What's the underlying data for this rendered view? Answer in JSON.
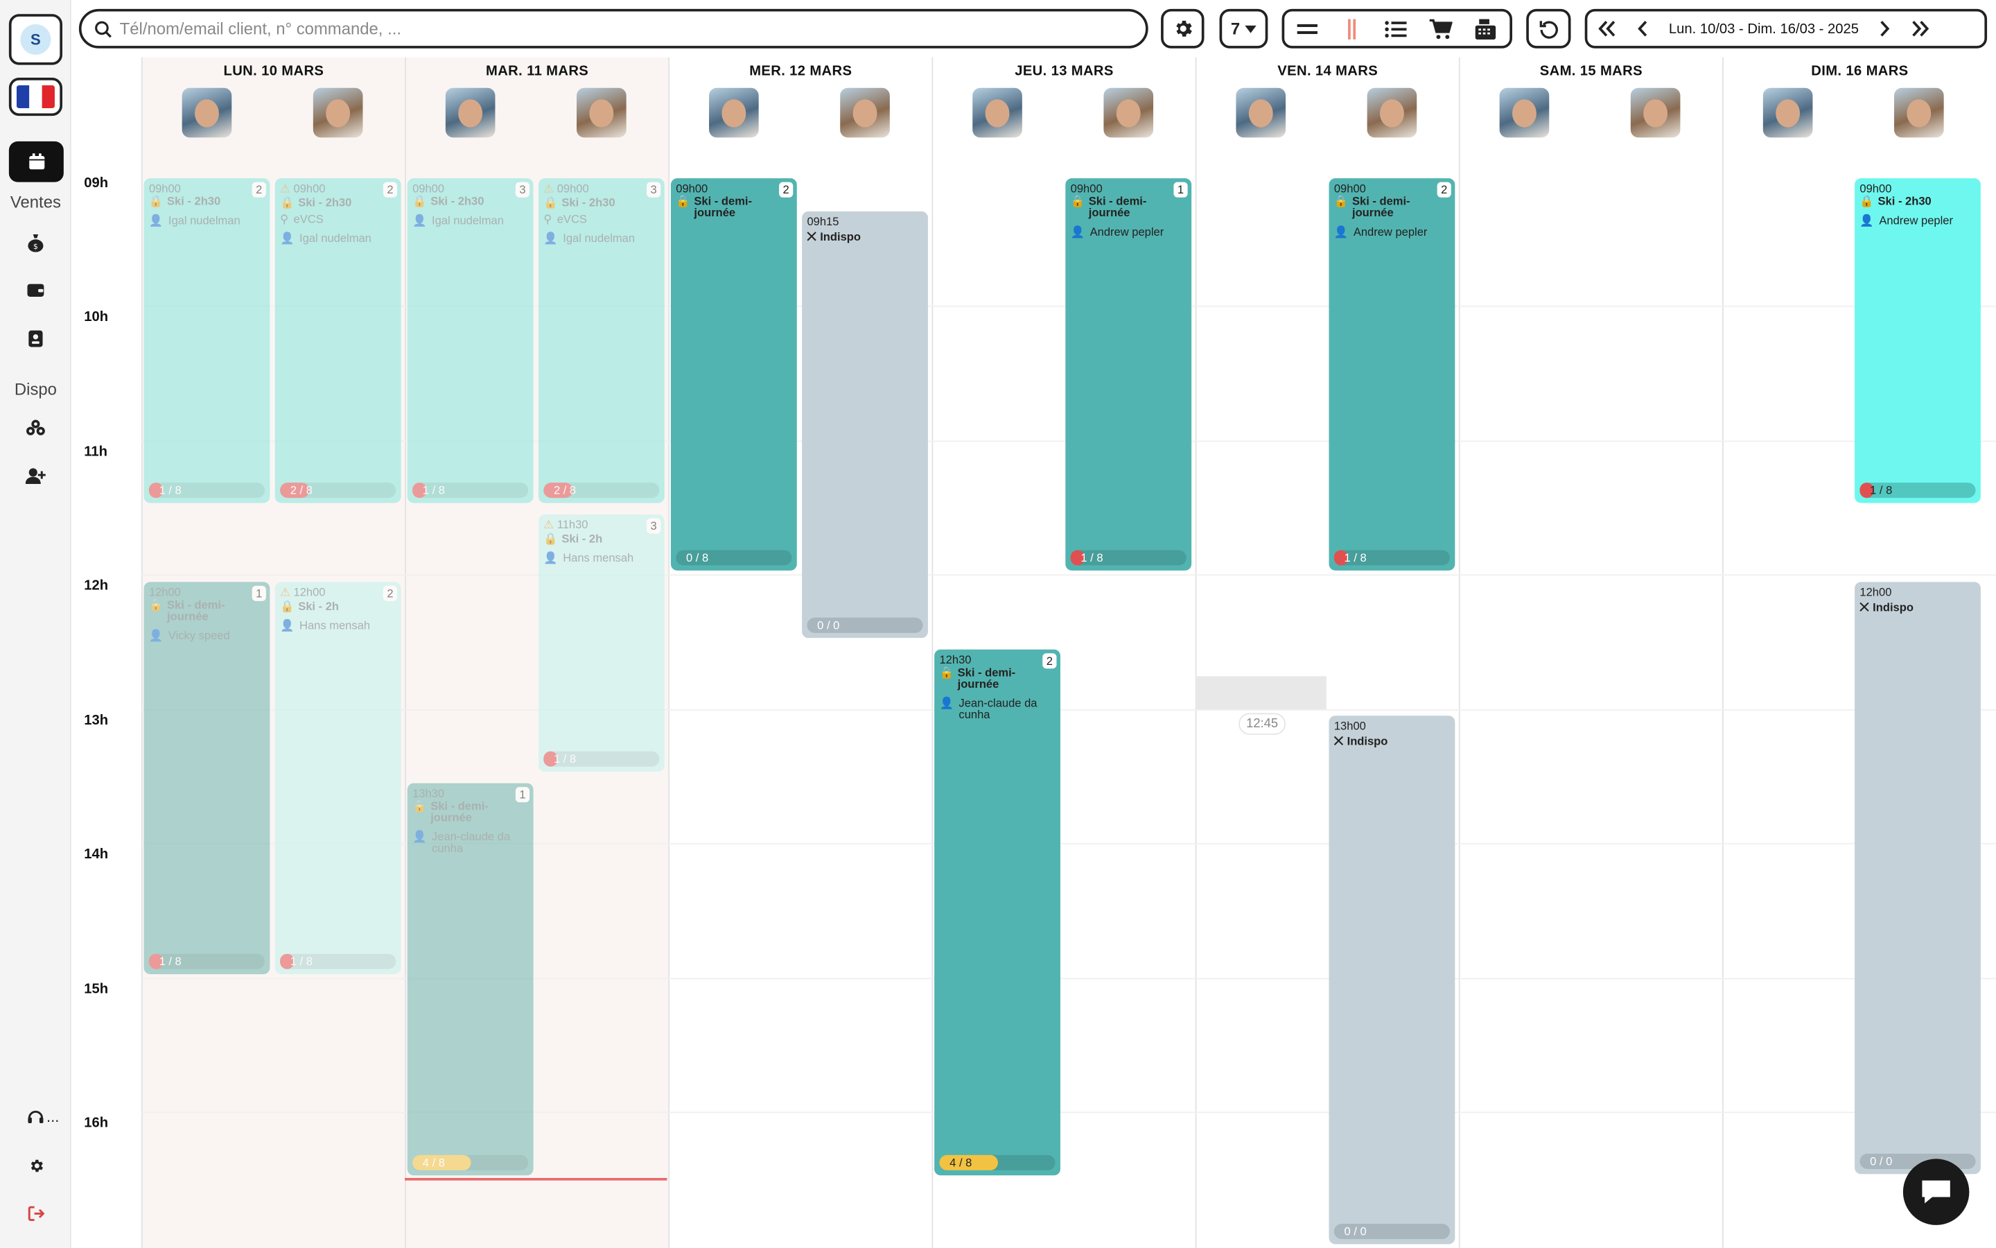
{
  "sidebar": {
    "user_initial": "S",
    "ventes_label": "Ventes",
    "dispo_label": "Dispo",
    "support_label": "..."
  },
  "search": {
    "placeholder": "Tél/nom/email client, n° commande, ..."
  },
  "toolbar": {
    "days_count": "7",
    "date_range": "Lun. 10/03 - Dim. 16/03 - 2025"
  },
  "times": [
    "09h",
    "10h",
    "11h",
    "12h",
    "13h",
    "14h",
    "15h",
    "16h"
  ],
  "days": [
    {
      "label": "LUN. 10 MARS"
    },
    {
      "label": "MAR. 11 MARS"
    },
    {
      "label": "MER. 12 MARS"
    },
    {
      "label": "JEU. 13 MARS"
    },
    {
      "label": "VEN. 14 MARS"
    },
    {
      "label": "SAM. 15 MARS"
    },
    {
      "label": "DIM. 16 MARS"
    }
  ],
  "events": [
    {
      "time": "09h00",
      "title": "Ski - 2h30",
      "who": "Igal nudelman",
      "count": "2",
      "progress": "1 / 8"
    },
    {
      "time": "09h00",
      "title": "Ski - 2h30",
      "location": "eVCS",
      "who": "Igal nudelman",
      "count": "2",
      "progress": "2 / 8"
    },
    {
      "time": "12h00",
      "title": "Ski - demi-journée",
      "who": "Vicky speed",
      "count": "1",
      "progress": "1 / 8"
    },
    {
      "time": "12h00",
      "title": "Ski - 2h",
      "who": "Hans mensah",
      "count": "2",
      "progress": "1 / 8"
    },
    {
      "time": "09h00",
      "title": "Ski - 2h30",
      "who": "Igal nudelman",
      "count": "3",
      "progress": "1 / 8"
    },
    {
      "time": "09h00",
      "title": "Ski - 2h30",
      "location": "eVCS",
      "who": "Igal nudelman",
      "count": "3",
      "progress": "2 / 8"
    },
    {
      "time": "11h30",
      "title": "Ski - 2h",
      "who": "Hans mensah",
      "count": "3",
      "progress": "1 / 8"
    },
    {
      "time": "13h30",
      "title": "Ski - demi-journée",
      "who": "Jean-claude da cunha",
      "count": "1",
      "progress": "4 / 8"
    },
    {
      "time": "09h00",
      "title": "Ski - demi-journée",
      "count": "2",
      "progress": "0 / 8"
    },
    {
      "time": "09h15",
      "title": "Indispo",
      "progress": "0 / 0"
    },
    {
      "time": "12h30",
      "title": "Ski - demi-journée",
      "who": "Jean-claude da cunha",
      "count": "2",
      "progress": "4 / 8"
    },
    {
      "time": "09h00",
      "title": "Ski - demi-journée",
      "who": "Andrew pepler",
      "count": "1",
      "progress": "1 / 8"
    },
    {
      "time": "09h00",
      "title": "Ski - demi-journée",
      "who": "Andrew pepler",
      "count": "2",
      "progress": "1 / 8"
    },
    {
      "time": "13h00",
      "title": "Indispo",
      "progress": "0 / 0"
    },
    {
      "time": "09h00",
      "title": "Ski - 2h30",
      "who": "Andrew pepler",
      "progress": "1 / 8"
    },
    {
      "time": "12h00",
      "title": "Indispo",
      "progress": "0 / 0"
    }
  ],
  "now_marker": "12:45",
  "colors": {
    "teal_strong": "#52b4b0",
    "teal_light": "#c3f2ec",
    "teal_faded": "#b4d9d4",
    "cyan_bright": "#6ef7ee",
    "indispo_gray": "#c5d1d8",
    "progress_red": "#e05050",
    "progress_yellow": "#f2c342"
  }
}
